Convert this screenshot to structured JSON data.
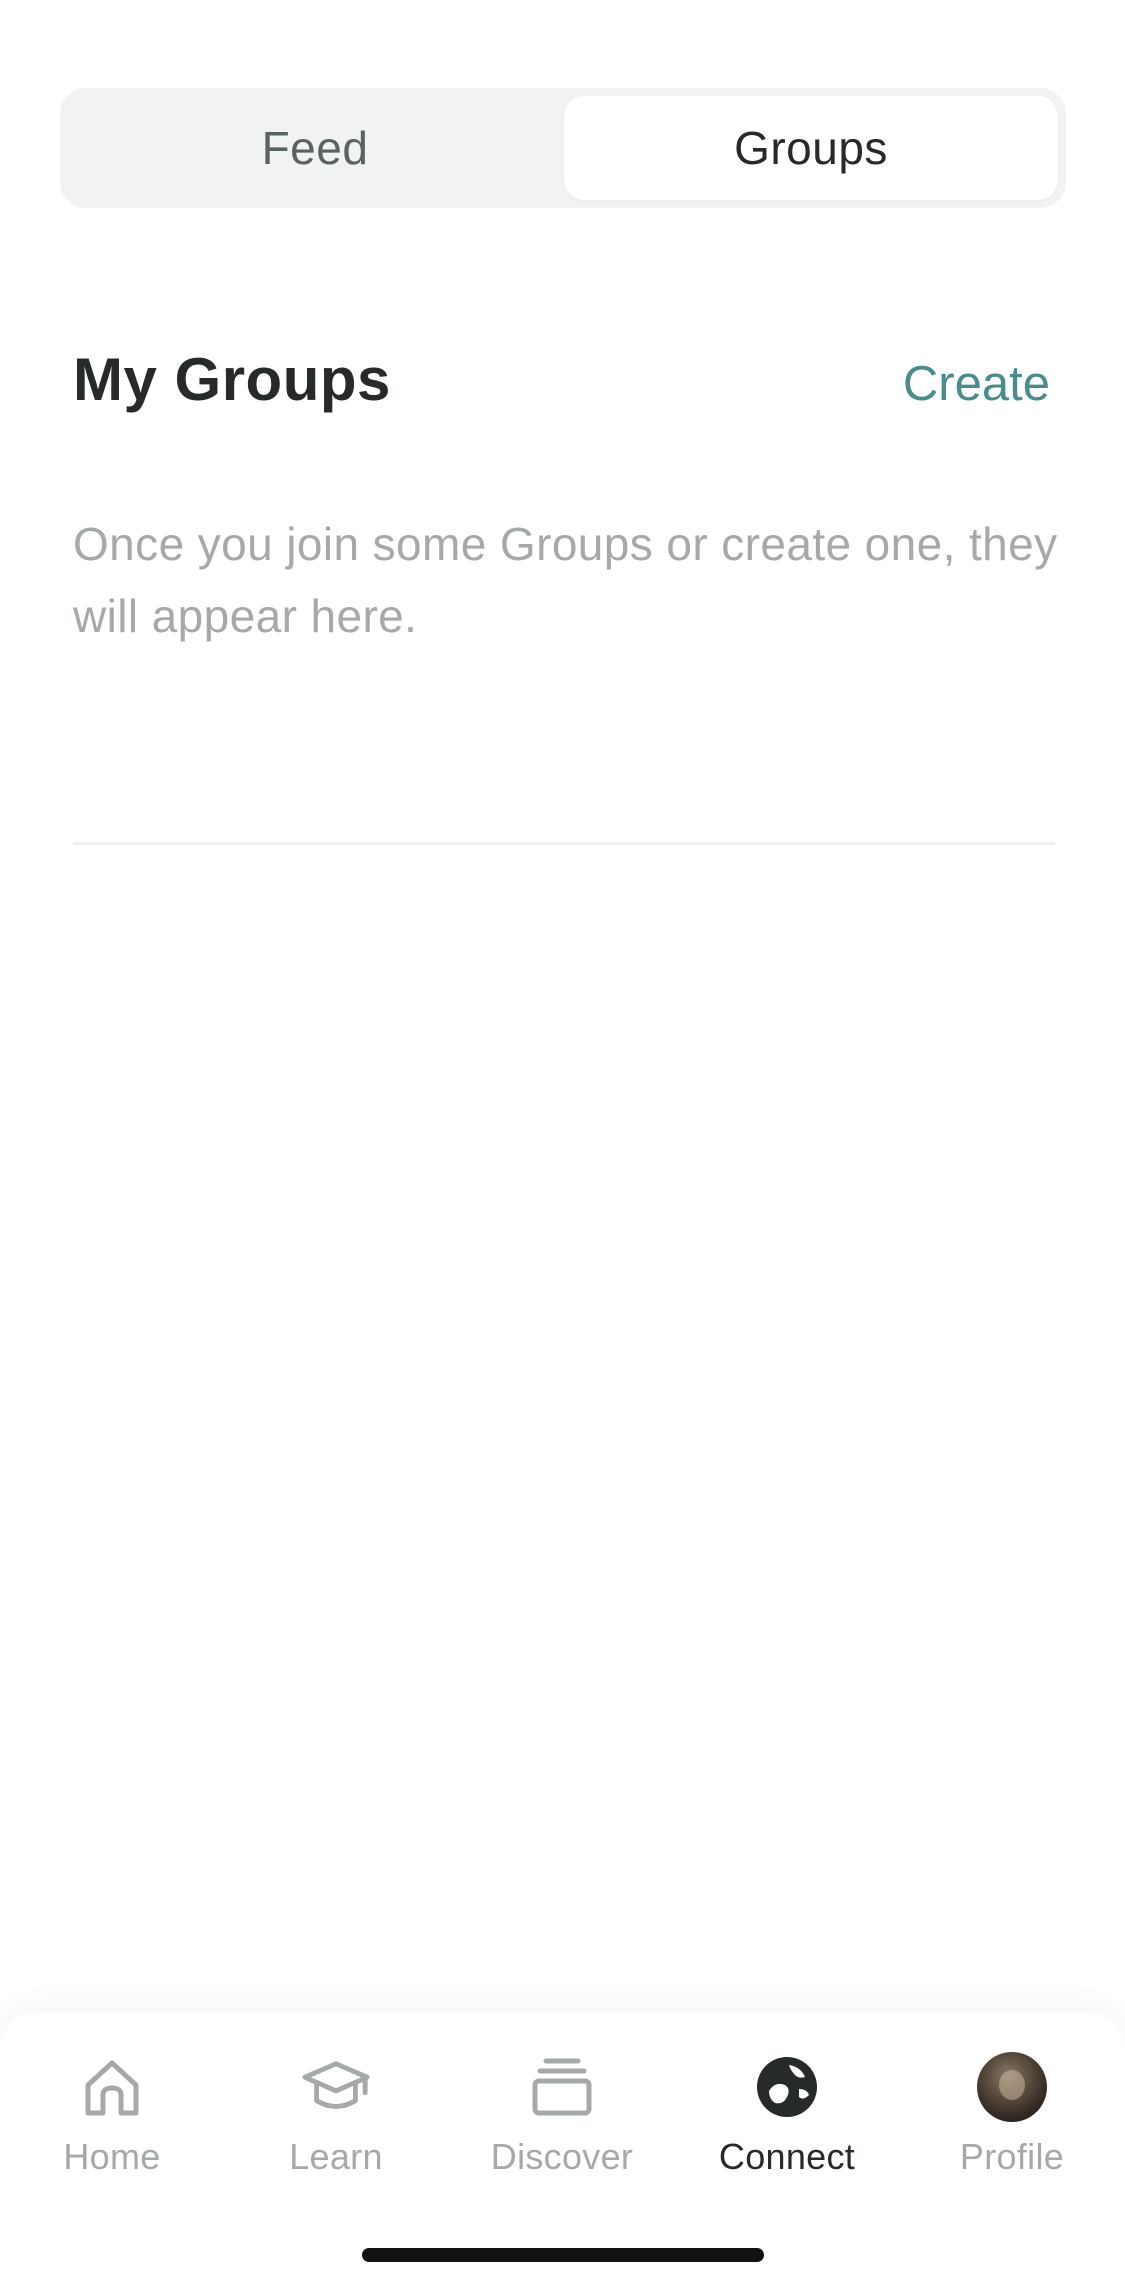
{
  "segmented_control": {
    "tabs": [
      {
        "label": "Feed",
        "selected": false
      },
      {
        "label": "Groups",
        "selected": true
      }
    ]
  },
  "my_groups": {
    "title": "My Groups",
    "create_label": "Create",
    "empty_message": "Once you join some Groups or create one, they will appear here."
  },
  "bottom_nav": {
    "items": [
      {
        "label": "Home",
        "icon": "home-icon",
        "active": false
      },
      {
        "label": "Learn",
        "icon": "graduation-cap-icon",
        "active": false
      },
      {
        "label": "Discover",
        "icon": "stack-icon",
        "active": false
      },
      {
        "label": "Connect",
        "icon": "globe-icon",
        "active": true
      },
      {
        "label": "Profile",
        "icon": "avatar",
        "active": false
      }
    ]
  },
  "colors": {
    "accent": "#4a8b8c",
    "text_primary": "#262a2b",
    "text_muted": "#a5a9aa",
    "segment_bg": "#f1f2f2"
  }
}
